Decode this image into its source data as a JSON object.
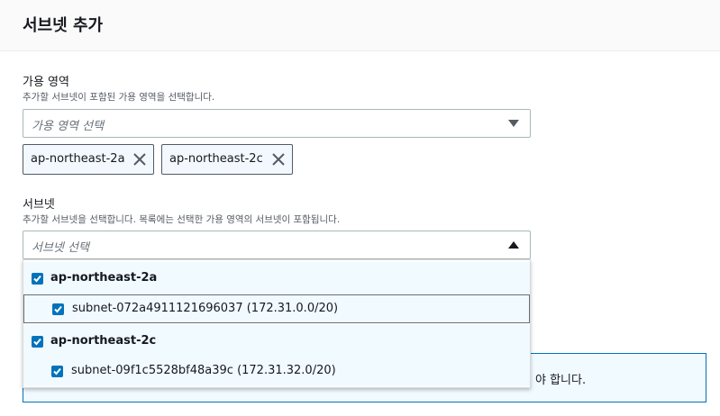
{
  "header": {
    "title": "서브넷 추가"
  },
  "az_field": {
    "label": "가용 영역",
    "description": "추가할 서브넷이 포함된 가용 영역을 선택합니다.",
    "placeholder": "가용 영역 선택",
    "caret_icon": "caret-down-icon",
    "tokens": [
      {
        "label": "ap-northeast-2a",
        "remove_icon": "close-icon"
      },
      {
        "label": "ap-northeast-2c",
        "remove_icon": "close-icon"
      }
    ]
  },
  "subnet_field": {
    "label": "서브넷",
    "description": "추가할 서브넷을 선택합니다. 목록에는 선택한 가용 영역의 서브넷이 포함됩니다.",
    "placeholder": "서브넷 선택",
    "caret_icon": "caret-up-icon",
    "dropdown": [
      {
        "type": "group",
        "label": "ap-northeast-2a",
        "checked": true
      },
      {
        "type": "option",
        "label": "subnet-072a4911121696037 (172.31.0.0/20)",
        "checked": true
      },
      {
        "type": "group",
        "label": "ap-northeast-2c",
        "checked": true
      },
      {
        "type": "option",
        "label": "subnet-09f1c5528bf48a39c (172.31.32.0/20)",
        "checked": true
      }
    ]
  },
  "info_box": {
    "text_tail": "야 합니다."
  },
  "colors": {
    "accent": "#0073bb",
    "token_bg": "#f2f8fd",
    "option_bg": "#f1faff",
    "border": "#aab7b8"
  }
}
